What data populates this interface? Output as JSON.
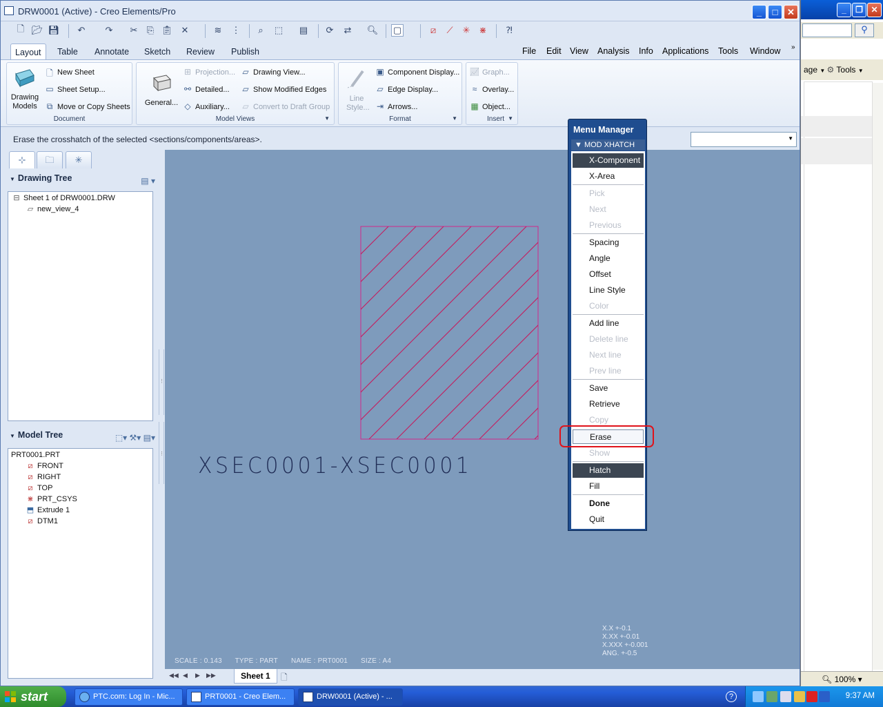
{
  "window": {
    "title": "DRW0001 (Active) - Creo Elements/Pro"
  },
  "menubar": [
    "File",
    "Edit",
    "View",
    "Analysis",
    "Info",
    "Applications",
    "Tools",
    "Window"
  ],
  "ribbon_tabs": [
    "Layout",
    "Table",
    "Annotate",
    "Sketch",
    "Review",
    "Publish"
  ],
  "ribbon": {
    "document": {
      "label": "Document",
      "big": "Drawing Models",
      "items": [
        "New Sheet",
        "Sheet Setup...",
        "Move or Copy Sheets"
      ]
    },
    "model_views": {
      "label": "Model Views",
      "big": "General...",
      "col1": [
        "Projection...",
        "Detailed...",
        "Auxiliary..."
      ],
      "col2": [
        "Drawing View...",
        "Show Modified Edges",
        "Convert to Draft Group"
      ]
    },
    "format": {
      "label": "Format",
      "big": "Line Style...",
      "items": [
        "Component Display...",
        "Edge Display...",
        "Arrows..."
      ]
    },
    "insert": {
      "label": "Insert",
      "items": [
        "Graph...",
        "Overlay...",
        "Object..."
      ]
    }
  },
  "message": "Erase the crosshatch of the selected <sections/components/areas>.",
  "drawing_tree": {
    "title": "Drawing Tree",
    "items": [
      "Sheet 1 of DRW0001.DRW",
      "new_view_4"
    ]
  },
  "model_tree": {
    "title": "Model Tree",
    "items": [
      "PRT0001.PRT",
      "FRONT",
      "RIGHT",
      "TOP",
      "PRT_CSYS",
      "Extrude 1",
      "DTM1"
    ]
  },
  "canvas": {
    "section_label": "XSEC0001-XSEC0001",
    "tolerances": [
      "X.X   +-0.1",
      "X.XX  +-0.01",
      "X.XXX  +-0.001",
      "ANG.  +-0.5"
    ],
    "info": [
      "SCALE : 0.143",
      "TYPE : PART",
      "NAME : PRT0001",
      "SIZE : A4"
    ],
    "sheet_tab": "Sheet 1"
  },
  "menu_manager": {
    "title": "Menu Manager",
    "submenu": "MOD XHATCH",
    "items": [
      "X-Component",
      "X-Area",
      "Pick",
      "Next",
      "Previous",
      "Spacing",
      "Angle",
      "Offset",
      "Line Style",
      "Color",
      "Add line",
      "Delete line",
      "Next line",
      "Prev line",
      "Save",
      "Retrieve",
      "Copy",
      "Erase",
      "Show",
      "Hatch",
      "Fill",
      "Done",
      "Quit"
    ]
  },
  "browser": {
    "commands": "age",
    "tools": "Tools",
    "zoom": "100%"
  },
  "taskbar": {
    "start": "start",
    "tasks": [
      "PTC.com: Log In - Mic...",
      "PRT0001 - Creo Elem...",
      "DRW0001 (Active) - ..."
    ],
    "clock": "9:37 AM"
  },
  "colors": {
    "canvas": "#7e9bbc",
    "hatch": "#c8175a",
    "menu_header": "#1f4d8f",
    "highlight": "#e0121a"
  }
}
